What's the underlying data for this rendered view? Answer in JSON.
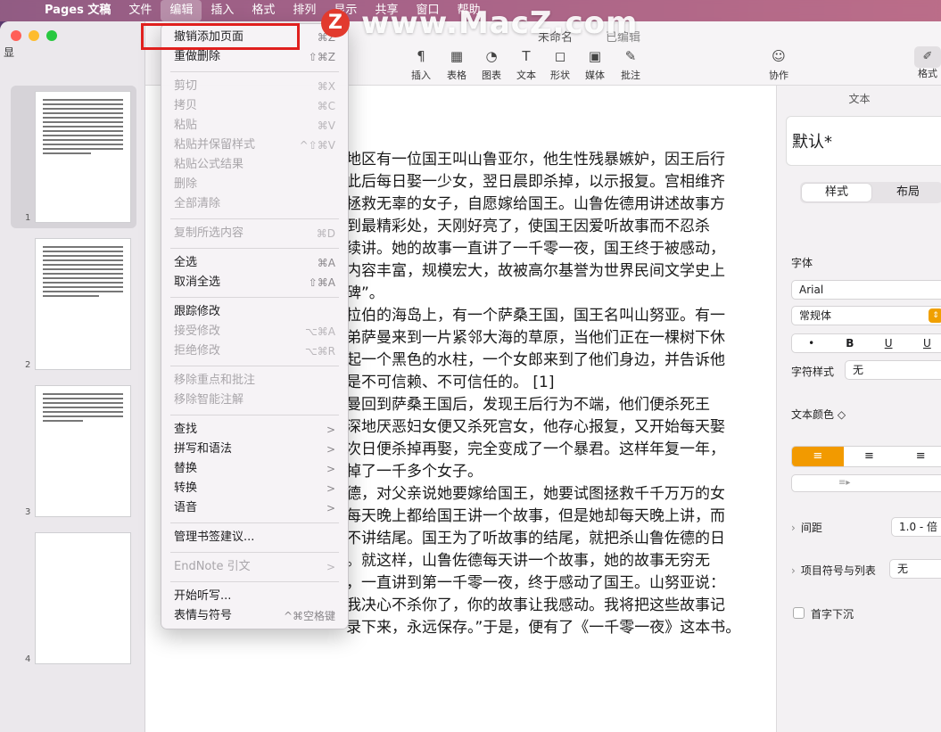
{
  "menubar": {
    "app": "Pages 文稿",
    "items": [
      "文件",
      "编辑",
      "插入",
      "格式",
      "排列",
      "显示",
      "共享",
      "窗口",
      "帮助"
    ]
  },
  "watermark": "www.MacZ.com",
  "watermark_logo": "Z",
  "sidebar": {
    "label": "显",
    "pages": [
      "1",
      "2",
      "3",
      "4"
    ]
  },
  "toolbar": {
    "doc_title": "未命名",
    "doc_status": "已编辑",
    "buttons": [
      {
        "label": "插入",
        "icon": "¶"
      },
      {
        "label": "表格",
        "icon": "▦"
      },
      {
        "label": "图表",
        "icon": "◔"
      },
      {
        "label": "文本",
        "icon": "T"
      },
      {
        "label": "形状",
        "icon": "◻"
      },
      {
        "label": "媒体",
        "icon": "▣"
      },
      {
        "label": "批注",
        "icon": "✎"
      }
    ],
    "collab": "协作",
    "format": "格式"
  },
  "document": {
    "lines": [
      "地区有一位国王叫山鲁亚尔，他生性残暴嫉妒，因王后行",
      "此后每日娶一少女，翌日晨即杀掉，以示报复。宫相维齐",
      "拯救无辜的女子，自愿嫁给国王。山鲁佐德用讲述故事方",
      "到最精彩处，天刚好亮了，使国王因爱听故事而不忍杀",
      "续讲。她的故事一直讲了一千零一夜，国王终于被感动，",
      "内容丰富，规模宏大，故被高尔基誉为世界民间文学史上",
      "碑”。",
      "拉伯的海岛上，有一个萨桑王国，国王名叫山努亚。有一",
      "弟萨曼来到一片紧邻大海的草原，当他们正在一棵树下休",
      "起一个黑色的水柱，一个女郎来到了他们身边，并告诉他",
      "是不可信赖、不可信任的。 [1]",
      "曼回到萨桑王国后，发现王后行为不端，他们便杀死王",
      "深地厌恶妇女便又杀死宫女，他存心报复，又开始每天娶",
      "次日便杀掉再娶，完全变成了一个暴君。这样年复一年，",
      "掉了一千多个女子。",
      "德，对父亲说她要嫁给国王，她要试图拯救千千万万的女",
      "每天晚上都给国王讲一个故事，但是她却每天晚上讲，而",
      "不讲结尾。国王为了听故事的结尾，就把杀山鲁佐德的日",
      "。就这样，山鲁佐德每天讲一个故事，她的故事无穷无",
      "，一直讲到第一千零一夜，终于感动了国王。山努亚说：",
      "  我决心不杀你了，你的故事让我感动。我将把这些故事记",
      "  录下来，永远保存。”于是，便有了《一千零一夜》这本书。"
    ]
  },
  "inspector": {
    "tab": "文本",
    "style_name": "默认*",
    "seg": [
      "样式",
      "布局"
    ],
    "font_label": "字体",
    "font_name": "Arial",
    "font_weight": "常规体",
    "text_buttons": [
      "•",
      "B",
      "U",
      "U"
    ],
    "char_style_label": "字符样式",
    "char_style_value": "无",
    "text_color_label": "文本颜色 ◇",
    "align": [
      "≡",
      "≡",
      "≡"
    ],
    "spacing_label": "间距",
    "spacing_value": "1.0 - 倍",
    "bullets_label": "项目符号与列表",
    "bullets_value": "无",
    "dropcap_label": "首字下沉"
  },
  "edit_menu": {
    "items": [
      {
        "label": "撤销添加页面",
        "shortcut": "⌘Z",
        "enabled": true
      },
      {
        "label": "重做删除",
        "shortcut": "⇧⌘Z",
        "enabled": true
      },
      {
        "sep": true
      },
      {
        "label": "剪切",
        "shortcut": "⌘X",
        "enabled": false
      },
      {
        "label": "拷贝",
        "shortcut": "⌘C",
        "enabled": false
      },
      {
        "label": "粘贴",
        "shortcut": "⌘V",
        "enabled": false
      },
      {
        "label": "粘贴并保留样式",
        "shortcut": "^⇧⌘V",
        "enabled": false
      },
      {
        "label": "粘贴公式结果",
        "shortcut": "",
        "enabled": false
      },
      {
        "label": "删除",
        "shortcut": "",
        "enabled": false
      },
      {
        "label": "全部清除",
        "shortcut": "",
        "enabled": false
      },
      {
        "sep": true
      },
      {
        "label": "复制所选内容",
        "shortcut": "⌘D",
        "enabled": false
      },
      {
        "sep": true
      },
      {
        "label": "全选",
        "shortcut": "⌘A",
        "enabled": true
      },
      {
        "label": "取消全选",
        "shortcut": "⇧⌘A",
        "enabled": true
      },
      {
        "sep": true
      },
      {
        "label": "跟踪修改",
        "shortcut": "",
        "enabled": true
      },
      {
        "label": "接受修改",
        "shortcut": "⌥⌘A",
        "enabled": false
      },
      {
        "label": "拒绝修改",
        "shortcut": "⌥⌘R",
        "enabled": false
      },
      {
        "sep": true
      },
      {
        "label": "移除重点和批注",
        "shortcut": "",
        "enabled": false
      },
      {
        "label": "移除智能注解",
        "shortcut": "",
        "enabled": false
      },
      {
        "sep": true
      },
      {
        "label": "查找",
        "shortcut": ">",
        "enabled": true
      },
      {
        "label": "拼写和语法",
        "shortcut": ">",
        "enabled": true
      },
      {
        "label": "替换",
        "shortcut": ">",
        "enabled": true
      },
      {
        "label": "转换",
        "shortcut": ">",
        "enabled": true
      },
      {
        "label": "语音",
        "shortcut": ">",
        "enabled": true
      },
      {
        "sep": true
      },
      {
        "label": "管理书签建议...",
        "shortcut": "",
        "enabled": true
      },
      {
        "sep": true
      },
      {
        "label": "EndNote 引文",
        "shortcut": ">",
        "enabled": false
      },
      {
        "sep": true
      },
      {
        "label": "开始听写...",
        "shortcut": "",
        "enabled": true
      },
      {
        "label": "表情与符号",
        "shortcut": "^⌘空格键",
        "enabled": true
      }
    ]
  }
}
